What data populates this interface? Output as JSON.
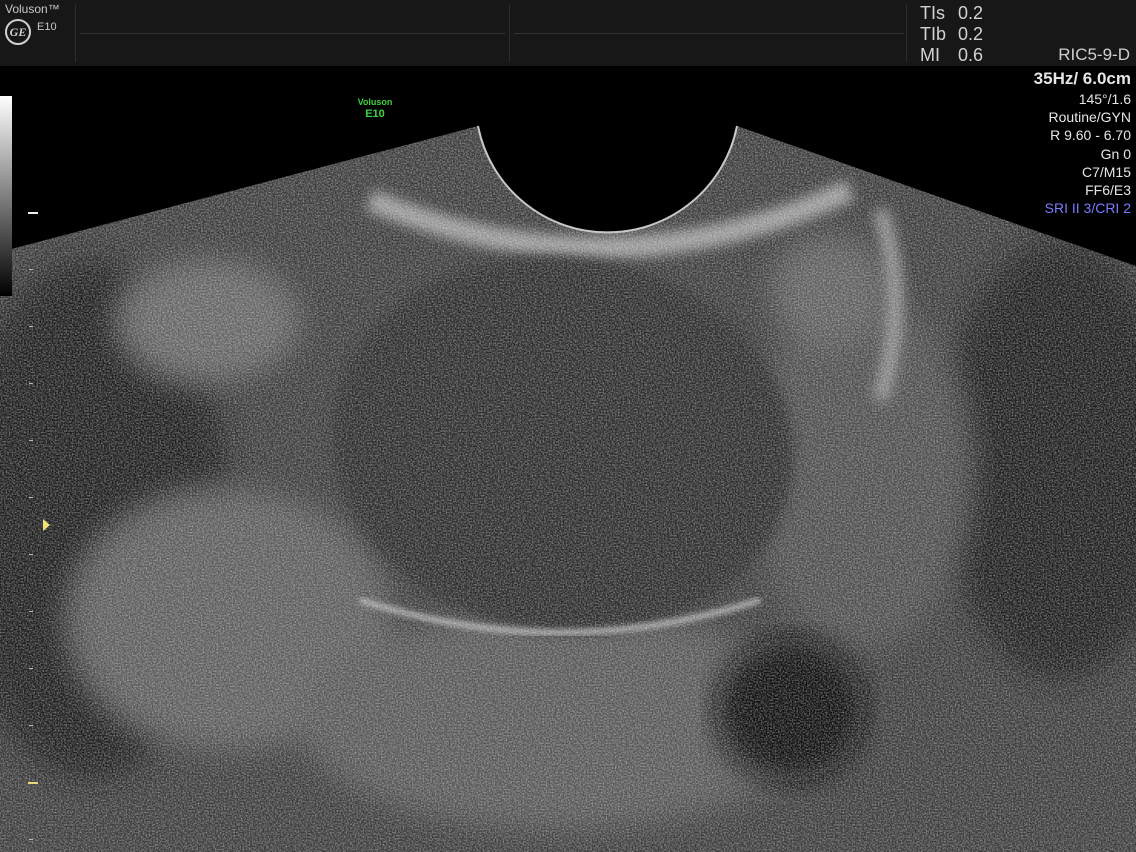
{
  "header": {
    "brand_name": "Voluson™",
    "brand_logo": "GE",
    "brand_model": "E10",
    "indices": [
      {
        "label": "TIs",
        "value": "0.2"
      },
      {
        "label": "TIb",
        "value": "0.2"
      },
      {
        "label": "MI",
        "value": "0.6"
      }
    ],
    "probe": "RIC5-9-D"
  },
  "params": {
    "frame_depth": "35Hz/ 6.0cm",
    "angle": "145°/1.6",
    "preset": "Routine/GYN",
    "frequency": "R 9.60 - 6.70",
    "gain": "Gn   0",
    "map": "C7/M15",
    "filter": "FF6/E3",
    "sri": "SRI II 3/CRI 2"
  },
  "watermark": {
    "line1": "Voluson",
    "line2": "E10"
  },
  "colors": {
    "header_bg": "#171717",
    "text": "#e6e6e6",
    "sri_text": "#7a7aff",
    "watermark": "#3fd23f",
    "focus_marker": "#f0e07a"
  },
  "icons": {
    "logo": "ge-logo-icon",
    "focus": "focus-marker-icon"
  }
}
